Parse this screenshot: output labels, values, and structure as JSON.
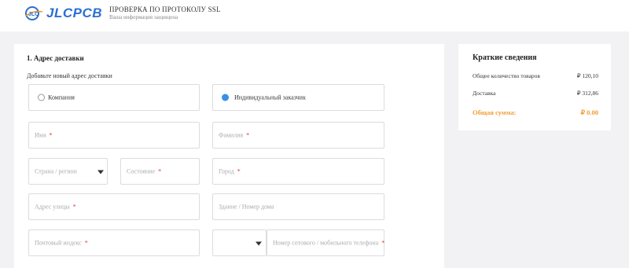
{
  "header": {
    "logo_text": "JLCPCB",
    "ssl_title": "ПРОВЕРКА ПО ПРОТОКОЛУ SSL",
    "ssl_subtitle": "Ваша информация защищена"
  },
  "delivery": {
    "section_title": "1. Адрес доставки",
    "add_new_label": "Добавьте новый адрес доставки",
    "customer_types": [
      {
        "label": "Компания",
        "selected": false
      },
      {
        "label": "Индивидуальный заказчик",
        "selected": true
      }
    ],
    "fields": {
      "first_name": "Имя",
      "last_name": "Фамилия",
      "country": "Страна / регион",
      "state": "Состояние",
      "city": "Город",
      "street": "Адрес улицы",
      "building": "Здание / Номер дома",
      "postal": "Почтовый индекс",
      "phone": "Номер сотового / мобильного телефона"
    },
    "required_mark": "*",
    "country_code_value": ""
  },
  "summary": {
    "title": "Краткие сведения",
    "rows": [
      {
        "label": "Общее количество товаров",
        "value": "₽ 120,10"
      },
      {
        "label": "Доставка",
        "value": "₽ 312,86"
      }
    ],
    "total_label": "Общая сумма:",
    "total_value": "₽ 0.00"
  },
  "colors": {
    "accent": "#3a8ee6",
    "brand": "#2c6fd1",
    "total": "#f39c34",
    "required": "#e53935"
  }
}
